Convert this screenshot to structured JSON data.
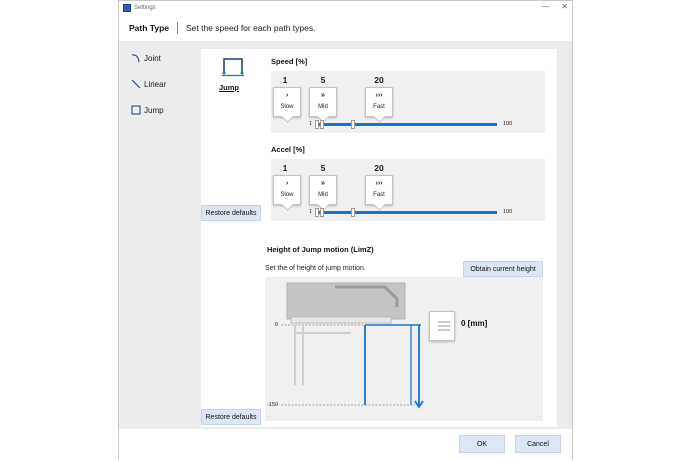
{
  "window": {
    "title": "Settings",
    "minimize": "—",
    "close": "✕"
  },
  "header": {
    "title": "Path Type",
    "description": "Set the speed for each path types."
  },
  "sidebar": {
    "items": [
      {
        "label": "Joint",
        "icon": "joint-icon"
      },
      {
        "label": "Linear",
        "icon": "linear-icon"
      },
      {
        "label": "Jump",
        "icon": "jump-icon"
      }
    ]
  },
  "panel": {
    "type_label": "Jump",
    "speed": {
      "title": "Speed [%]",
      "presets": [
        {
          "value": "1",
          "glyph": "›",
          "label": "Slow"
        },
        {
          "value": "5",
          "glyph": "»",
          "label": "Mid"
        },
        {
          "value": "20",
          "glyph": "›››",
          "label": "Fast"
        }
      ],
      "min_label": "1",
      "max_label": "100"
    },
    "accel": {
      "title": "Accel [%]",
      "presets": [
        {
          "value": "1",
          "glyph": "›",
          "label": "Slow"
        },
        {
          "value": "5",
          "glyph": "»",
          "label": "Mid"
        },
        {
          "value": "20",
          "glyph": "›››",
          "label": "Fast"
        }
      ],
      "min_label": "1",
      "max_label": "100"
    },
    "restore_defaults_label": "Restore defaults",
    "limz": {
      "title": "Height of Jump motion (LimZ)",
      "description": "Set the of height of jump motion.",
      "obtain_label": "Obtain current height",
      "axis_top": "0",
      "axis_bottom": "-150",
      "value_display": "0 [mm]"
    }
  },
  "footer": {
    "ok_label": "OK",
    "cancel_label": "Cancel"
  },
  "colors": {
    "accent": "#1574d4",
    "button_bg": "#dce6f4"
  }
}
